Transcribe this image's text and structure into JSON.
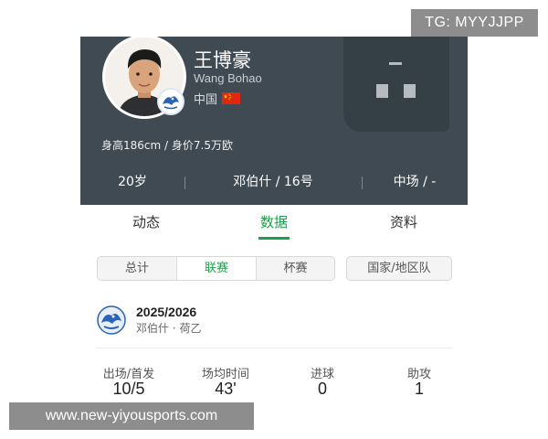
{
  "colors": {
    "header_bg": "#3f4a52",
    "accent_green": "#1aa14b",
    "watermark_bg": "#8d8d8d"
  },
  "watermark": {
    "top": "TG: MYYJJPP",
    "bottom": "www.new-yiyousports.com"
  },
  "player": {
    "name": "王博豪",
    "name_en": "Wang Bohao",
    "nationality": "中国",
    "flag_icon": "china-flag-icon",
    "bio": "身高186cm / 身价7.5万欧",
    "age": "20岁",
    "club_number": "邓伯什 / 16号",
    "position": "中场 / -"
  },
  "tabs": [
    {
      "label": "动态",
      "active": false
    },
    {
      "label": "数据",
      "active": true
    },
    {
      "label": "资料",
      "active": false
    }
  ],
  "filters": {
    "segments": [
      {
        "label": "总计",
        "active": false
      },
      {
        "label": "联赛",
        "active": true
      },
      {
        "label": "杯赛",
        "active": false
      }
    ],
    "national_team": "国家/地区队"
  },
  "season": {
    "title": "2025/2026",
    "subtitle": "邓伯什 · 荷乙",
    "logo_icon": "club-logo-icon",
    "stats": [
      {
        "label": "出场/首发",
        "value": "10/5"
      },
      {
        "label": "场均时间",
        "value": "43'"
      },
      {
        "label": "进球",
        "value": "0"
      },
      {
        "label": "助攻",
        "value": "1"
      }
    ]
  }
}
